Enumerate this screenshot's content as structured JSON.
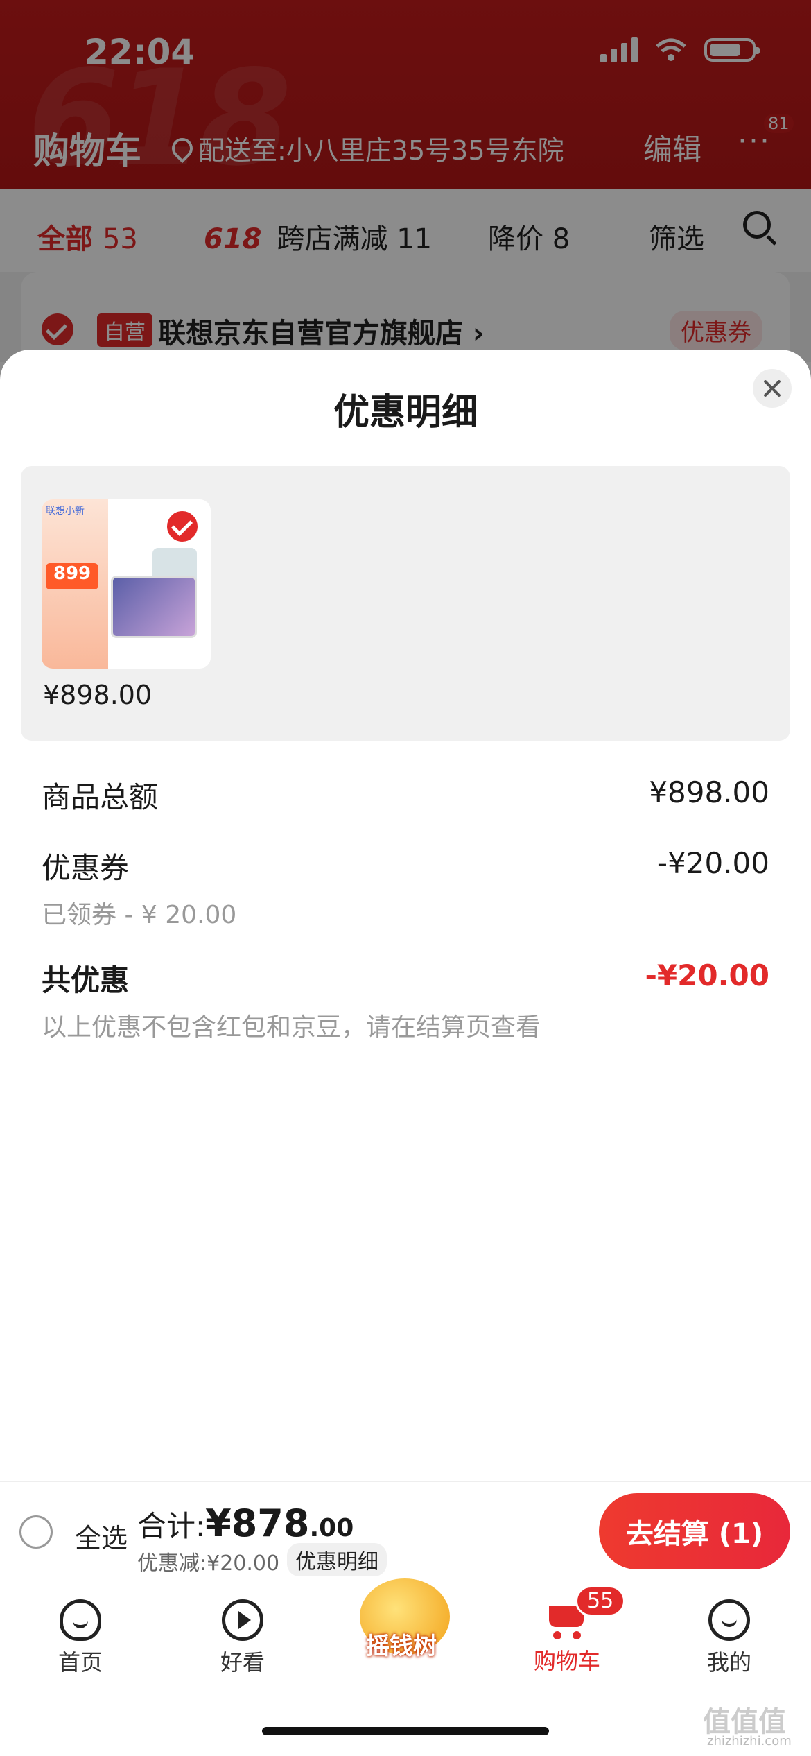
{
  "status_bar": {
    "time": "22:04"
  },
  "header": {
    "watermark": "618",
    "title": "购物车",
    "address": "配送至:小八里庄35号35号东院",
    "edit": "编辑",
    "more": "···",
    "more_badge": "81"
  },
  "tabs": {
    "all_label": "全部",
    "all_count": "53",
    "promo_logo": "618",
    "promo_label": "跨店满减",
    "promo_count": "11",
    "price_drop_label": "降价",
    "price_drop_count": "8",
    "filter": "筛选"
  },
  "store": {
    "self_tag": "自营",
    "name": "联想京东自营官方旗舰店 ›",
    "coupon": "优惠券"
  },
  "sheet": {
    "title": "优惠明细",
    "product": {
      "image_brand": "联想小新",
      "image_price": "899",
      "price": "¥898.00"
    },
    "rows": {
      "subtotal_label": "商品总额",
      "subtotal_value": "¥898.00",
      "coupon_label": "优惠券",
      "coupon_value": "-¥20.00",
      "coupon_sub": "已领券 - ¥ 20.00",
      "total_discount_label": "共优惠",
      "total_discount_value": "-¥20.00",
      "note": "以上优惠不包含红包和京豆，请在结算页查看"
    }
  },
  "checkout": {
    "select_all": "全选",
    "total_label": "合计:",
    "total_currency": "¥",
    "total_int": "878",
    "total_dec": ".00",
    "discount": "优惠减:¥20.00",
    "detail_chip": "优惠明细",
    "button": "去结算 (1)"
  },
  "tabbar": {
    "home": "首页",
    "watch": "好看",
    "tree": "摇钱树",
    "cart": "购物车",
    "cart_badge": "55",
    "me": "我的"
  },
  "watermark": {
    "site": "值值值",
    "url": "zhizhizhi.com"
  },
  "colors": {
    "brand_red": "#e22a2a",
    "header_red": "#c51c1c"
  }
}
